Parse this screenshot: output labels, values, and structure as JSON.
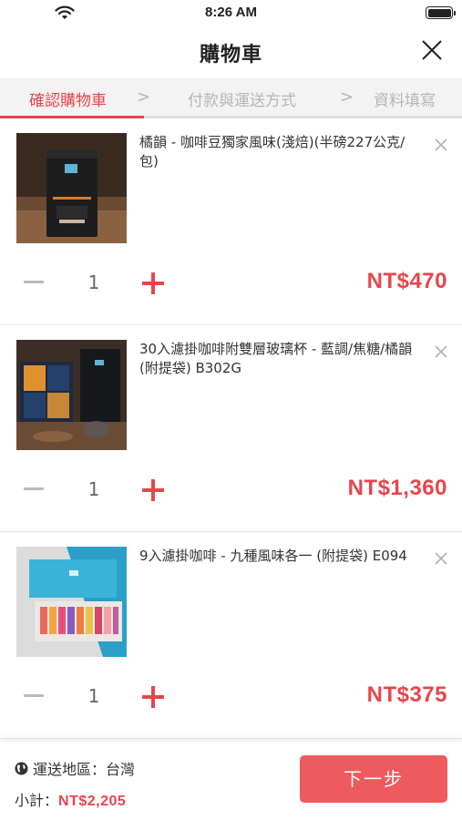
{
  "status_bar": {
    "time": "8:26 AM"
  },
  "header": {
    "title": "購物車"
  },
  "steps": [
    {
      "label": "確認購物車"
    },
    {
      "label": "付款與運送方式"
    },
    {
      "label": "資料填寫"
    }
  ],
  "step_separator": ">",
  "cart": {
    "items": [
      {
        "name": "橘韻 - 咖啡豆獨家風味(淺焙)(半磅227公克/包)",
        "quantity": "1",
        "price": "NT$470",
        "image": "coffee-bean-bag"
      },
      {
        "name": "30入濾掛咖啡附雙層玻璃杯 - 藍調/焦糖/橘韻 (附提袋) B302G",
        "quantity": "1",
        "price": "NT$1,360",
        "image": "drip-coffee-gift-box-with-glass"
      },
      {
        "name": "9入濾掛咖啡 - 九種風味各一 (附提袋) E094",
        "quantity": "1",
        "price": "NT$375",
        "image": "drip-coffee-9-pack"
      }
    ]
  },
  "footer": {
    "ship_label": "運送地區：台灣",
    "subtotal_label": "小計：",
    "subtotal_amount": "NT$2,205",
    "next_label": "下一步"
  },
  "colors": {
    "accent": "#e8454b",
    "button": "#ef5a5f",
    "inactive": "#b5b5b5"
  }
}
